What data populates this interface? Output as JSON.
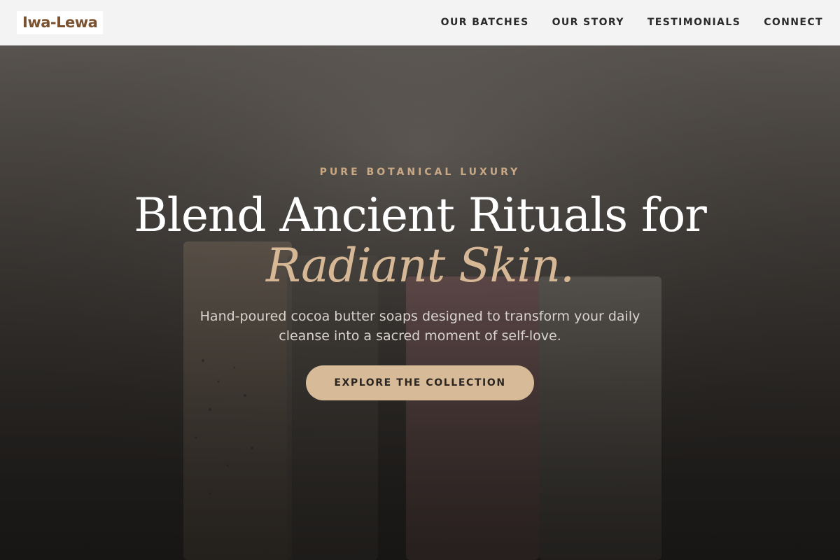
{
  "navbar": {
    "brand": "Iwa-Lewa",
    "links": [
      "OUR BATCHES",
      "OUR STORY",
      "TESTIMONIALS",
      "CONNECT"
    ]
  },
  "hero": {
    "eyebrow": "PURE BOTANICAL LUXURY",
    "headline_line1": "Blend Ancient Rituals for",
    "headline_line2": "Radiant Skin.",
    "subtext": "Hand-poured cocoa butter soaps designed to transform your daily cleanse into a sacred moment of self-love.",
    "cta_label": "EXPLORE THE COLLECTION"
  },
  "colors": {
    "brand": "#7a5230",
    "accent": "#d7b896",
    "button": "#d7bb98",
    "nav_text": "#2a2a2a"
  }
}
